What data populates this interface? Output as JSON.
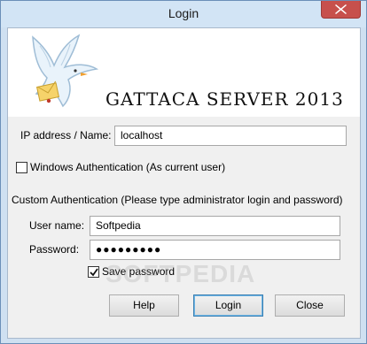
{
  "window": {
    "title": "Login"
  },
  "banner": {
    "app_title": "GATTACA SERVER 2013"
  },
  "form": {
    "ip_label": "IP address / Name:",
    "ip_value": "localhost",
    "windows_auth_label": "Windows Authentication (As current user)",
    "windows_auth_checked": false,
    "custom_auth_label": "Custom Authentication (Please type administrator login and password)",
    "user_label": "User name:",
    "user_value": "Softpedia",
    "password_label": "Password:",
    "password_value": "●●●●●●●●●",
    "save_password_label": "Save password",
    "save_password_checked": true
  },
  "buttons": {
    "help": "Help",
    "login": "Login",
    "close": "Close"
  },
  "watermark": "SOFTPEDIA"
}
